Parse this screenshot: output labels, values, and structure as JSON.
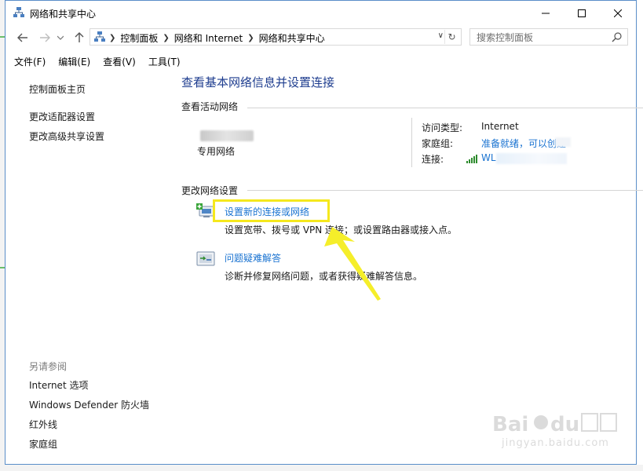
{
  "window": {
    "title": "网络和共享中心"
  },
  "nav": {
    "breadcrumbs": [
      "控制面板",
      "网络和 Internet",
      "网络和共享中心"
    ],
    "search_placeholder": "搜索控制面板"
  },
  "menu": [
    "文件(F)",
    "编辑(E)",
    "查看(V)",
    "工具(T)"
  ],
  "left_pane": {
    "links": [
      "控制面板主页",
      "更改适配器设置",
      "更改高级共享设置"
    ],
    "see_also_label": "另请参阅",
    "see_also": [
      "Internet 选项",
      "Windows Defender 防火墙",
      "红外线",
      "家庭组"
    ]
  },
  "main": {
    "title": "查看基本网络信息并设置连接",
    "active_networks_label": "查看活动网络",
    "network_type": "专用网络",
    "access_type_label": "访问类型:",
    "access_type_value": "Internet",
    "homegroup_label": "家庭组:",
    "homegroup_value": "准备就绪，可以创建",
    "connection_label": "连接:",
    "connection_value": "WL",
    "change_settings_label": "更改网络设置",
    "tasks": [
      {
        "link": "设置新的连接或网络",
        "desc": "设置宽带、拨号或 VPN 连接；或设置路由器或接入点。"
      },
      {
        "link": "问题疑难解答",
        "desc": "诊断并修复网络问题，或者获得疑难解答信息。"
      }
    ]
  },
  "watermark": {
    "text": "jingyan.baidu.com"
  },
  "colors": {
    "link": "#1a73d1",
    "title_blue": "#1e3d8f",
    "highlight": "#f5e81d"
  }
}
